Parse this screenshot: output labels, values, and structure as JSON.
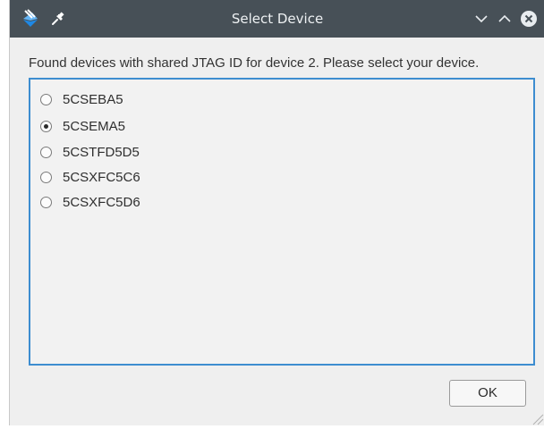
{
  "window": {
    "title": "Select Device",
    "icons": {
      "app": "app-logo-icon",
      "pin": "pin-icon",
      "minimize": "chevron-down-icon",
      "maximize": "chevron-up-icon",
      "close": "close-icon"
    }
  },
  "dialog": {
    "message": "Found devices with shared JTAG ID for device 2. Please select your device.",
    "devices": [
      {
        "label": "5CSEBA5",
        "selected": false
      },
      {
        "label": "5CSEMA5",
        "selected": true
      },
      {
        "label": "5CSTFD5D5",
        "selected": false
      },
      {
        "label": "5CSXFC5C6",
        "selected": false
      },
      {
        "label": "5CSXFC5D6",
        "selected": false
      }
    ],
    "ok_label": "OK"
  },
  "colors": {
    "titlebar": "#475057",
    "accent": "#3d8dd0",
    "background": "#efefef"
  }
}
